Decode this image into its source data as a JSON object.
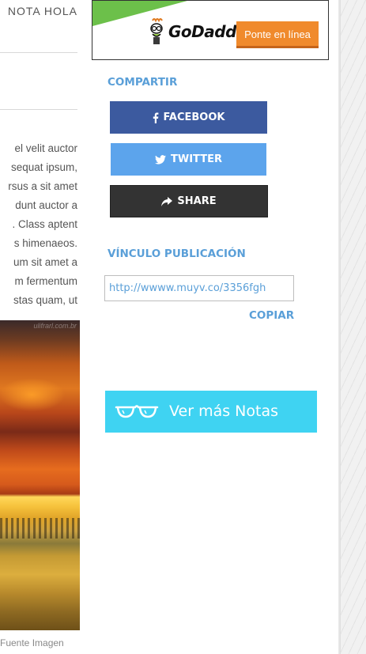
{
  "article": {
    "title_tail": "NOTA  HOLA",
    "body_lines": [
      "el velit auctor",
      "sequat ipsum,",
      "rsus a sit amet",
      "dunt auctor a",
      ". Class aptent",
      "s himenaeos.",
      "um sit amet a",
      "m fermentum",
      "stas quam, ut"
    ],
    "image_watermark": "ulifrarl.com.br",
    "image_caption": "Fuente Imagen"
  },
  "ad": {
    "brand": "GoDaddy",
    "cta": "Ponte en línea",
    "colors": {
      "green": "#6cc04a",
      "orange": "#f08a2c"
    }
  },
  "share": {
    "heading": "COMPARTIR",
    "facebook_label": "FACEBOOK",
    "twitter_label": "TWITTER",
    "share_label": "SHARE",
    "colors": {
      "facebook": "#3c5a9f",
      "twitter": "#5ca4ec",
      "share": "#333333"
    },
    "icons": {
      "facebook": "facebook-icon",
      "twitter": "twitter-icon",
      "share": "share-arrow-icon"
    }
  },
  "link": {
    "heading": "VÍNCULO PUBLICACIÓN",
    "url_value": "http://wwww.muyv.co/3356fgh",
    "copy_label": "COPIAR"
  },
  "more_notes": {
    "label": "Ver más Notas",
    "icon": "glasses-icon",
    "color": "#3fd3f2"
  },
  "theme": {
    "accent": "#5a9fd8"
  }
}
